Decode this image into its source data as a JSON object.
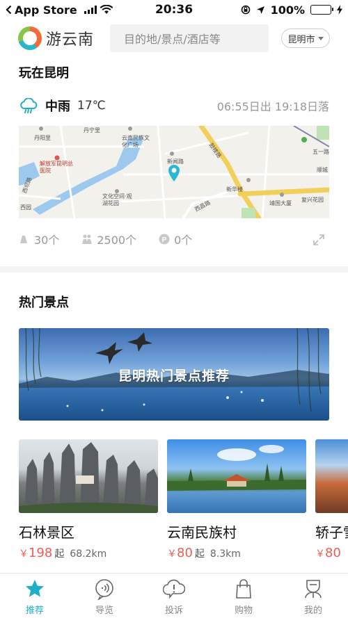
{
  "status_bar": {
    "carrier": "App Store",
    "time": "20:36",
    "battery": "100%",
    "battery_level": 1.0
  },
  "header": {
    "logo_text": "游云南",
    "search_placeholder": "目的地/景点/酒店等",
    "city": "昆明市"
  },
  "play_section": {
    "title": "玩在昆明",
    "weather": {
      "icon": "cloud-rain-icon",
      "condition": "中雨",
      "temperature": "17℃",
      "sun_times": "06:55日出 19:18日落"
    },
    "map": {
      "labels": [
        "丹宁里",
        "丹阳里",
        "云南民族文化广场",
        "解放军昆明总医院",
        "新闻路",
        "文化空间·观湖花园",
        "新华楼",
        "五一路",
        "顺城",
        "靖国大厦",
        "复兴花园",
        "西昌路",
        "鼓楼路",
        "西坝路",
        "西园"
      ]
    },
    "stats": [
      {
        "icon": "toilet-icon",
        "value": "30个"
      },
      {
        "icon": "people-icon",
        "value": "2500个"
      },
      {
        "icon": "parking-icon",
        "value": "0个"
      }
    ]
  },
  "hot_section": {
    "title": "热门景点",
    "banner_title": "昆明热门景点推荐",
    "attractions": [
      {
        "name": "石林景区",
        "price_symbol": "￥",
        "price": "198",
        "price_suffix": "起",
        "distance": "68.2km"
      },
      {
        "name": "云南民族村",
        "price_symbol": "￥",
        "price": "80",
        "price_suffix": "起",
        "distance": "8.3km"
      },
      {
        "name": "轿子雪山",
        "price_symbol": "￥",
        "price": "80",
        "price_suffix": "",
        "distance": ""
      }
    ]
  },
  "tab_bar": {
    "active_color": "#1fb0c6",
    "tabs": [
      {
        "label": "推荐",
        "icon": "star-icon",
        "active": true
      },
      {
        "label": "导览",
        "icon": "audio-guide-icon",
        "active": false
      },
      {
        "label": "投诉",
        "icon": "complaint-icon",
        "active": false
      },
      {
        "label": "购物",
        "icon": "shopping-bag-icon",
        "active": false
      },
      {
        "label": "我的",
        "icon": "profile-icon",
        "active": false
      }
    ]
  }
}
